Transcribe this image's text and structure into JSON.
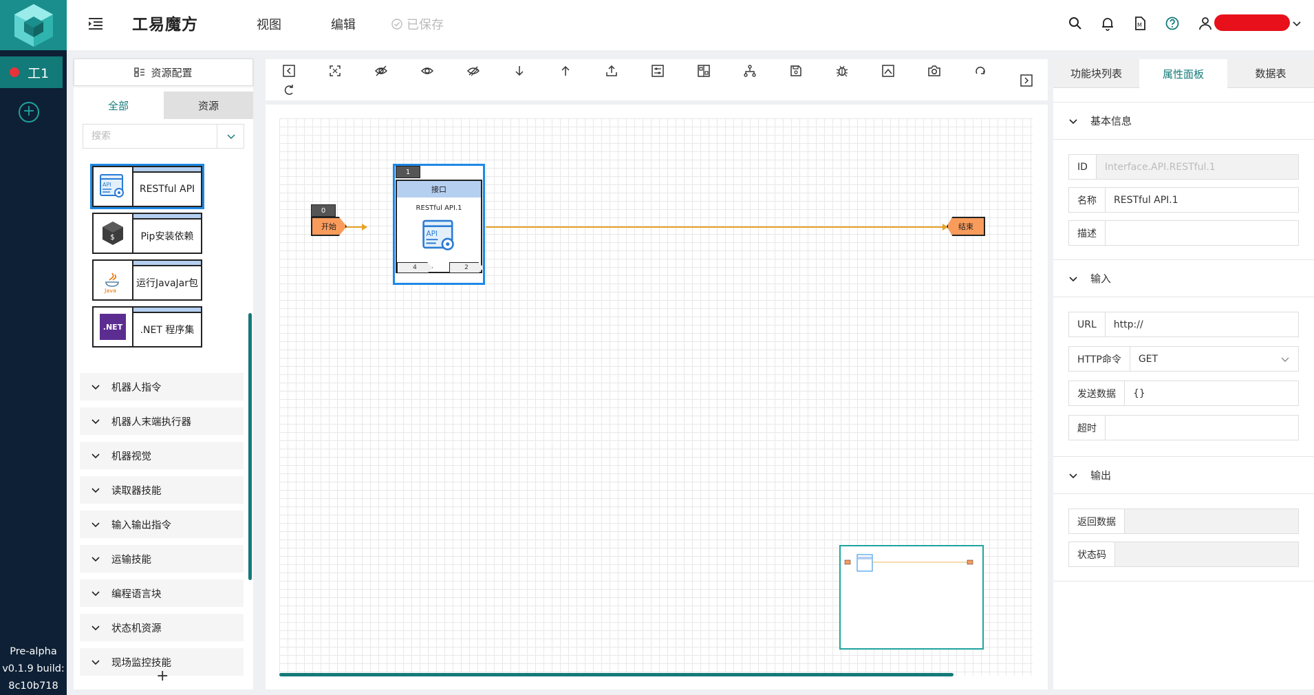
{
  "app": {
    "title": "工易魔方",
    "menus": [
      "视图",
      "编辑"
    ],
    "saved_status": "已保存"
  },
  "appbar": {
    "work_tab": "工1",
    "version_lines": [
      "Pre-alpha",
      "v0.1.9 build:",
      "8c10b718"
    ]
  },
  "colors": {
    "accent": "#127a78",
    "appbar_bg": "#0e2035",
    "selection": "#1e88e5",
    "terminal": "#f99c5b",
    "block_stripe": "#b4cff0",
    "status_dot": "#e8333a"
  },
  "left": {
    "config_label": "资源配置",
    "tabs": [
      "全部",
      "资源"
    ],
    "search_placeholder": "搜索",
    "blocks": [
      {
        "label": "RESTful API",
        "icon": "api-icon"
      },
      {
        "label": "Pip安装依赖",
        "icon": "terminal-icon"
      },
      {
        "label": "运行JavaJar包",
        "icon": "java-icon",
        "icon_text": "Java"
      },
      {
        "label": ".NET 程序集",
        "icon": "dotnet-icon",
        "icon_text": ".NET"
      }
    ],
    "categories": [
      "机器人指令",
      "机器人末端执行器",
      "机器视觉",
      "读取器技能",
      "输入输出指令",
      "运输技能",
      "编程语言块",
      "状态机资源",
      "现场监控技能"
    ]
  },
  "toolbar_icons": [
    "collapse-left-icon",
    "fit-screen-icon",
    "hide-icon",
    "show-icon",
    "hide-all-icon",
    "arrow-down-icon",
    "arrow-up-icon",
    "upload-icon",
    "settings-sliders-icon",
    "layout-icon",
    "hierarchy-icon",
    "save-icon",
    "debug-icon",
    "image-icon",
    "camera-icon",
    "redo-icon",
    "expand-right-icon",
    "refresh-icon"
  ],
  "flow": {
    "start": {
      "num": "0",
      "label": "开始"
    },
    "node": {
      "num": "1",
      "header": "接口",
      "name": "RESTful API.1",
      "in_port": "4",
      "out_port": "2"
    },
    "end": {
      "label": "结束"
    }
  },
  "right": {
    "tabs": [
      "功能块列表",
      "属性面板",
      "数据表"
    ],
    "active_tab": "属性面板",
    "sections": {
      "basic": "基本信息",
      "input": "输入",
      "output": "输出"
    },
    "basic_fields": {
      "id_label": "ID",
      "id_value": "Interface.API.RESTful.1",
      "name_label": "名称",
      "name_value": "RESTful API.1",
      "desc_label": "描述",
      "desc_value": ""
    },
    "input_fields": {
      "url_label": "URL",
      "url_value": "http://",
      "method_label": "HTTP命令",
      "method_value": "GET",
      "send_label": "发送数据",
      "send_value": "{}",
      "timeout_label": "超时",
      "timeout_value": ""
    },
    "output_fields": {
      "return_label": "返回数据",
      "status_label": "状态码"
    }
  }
}
